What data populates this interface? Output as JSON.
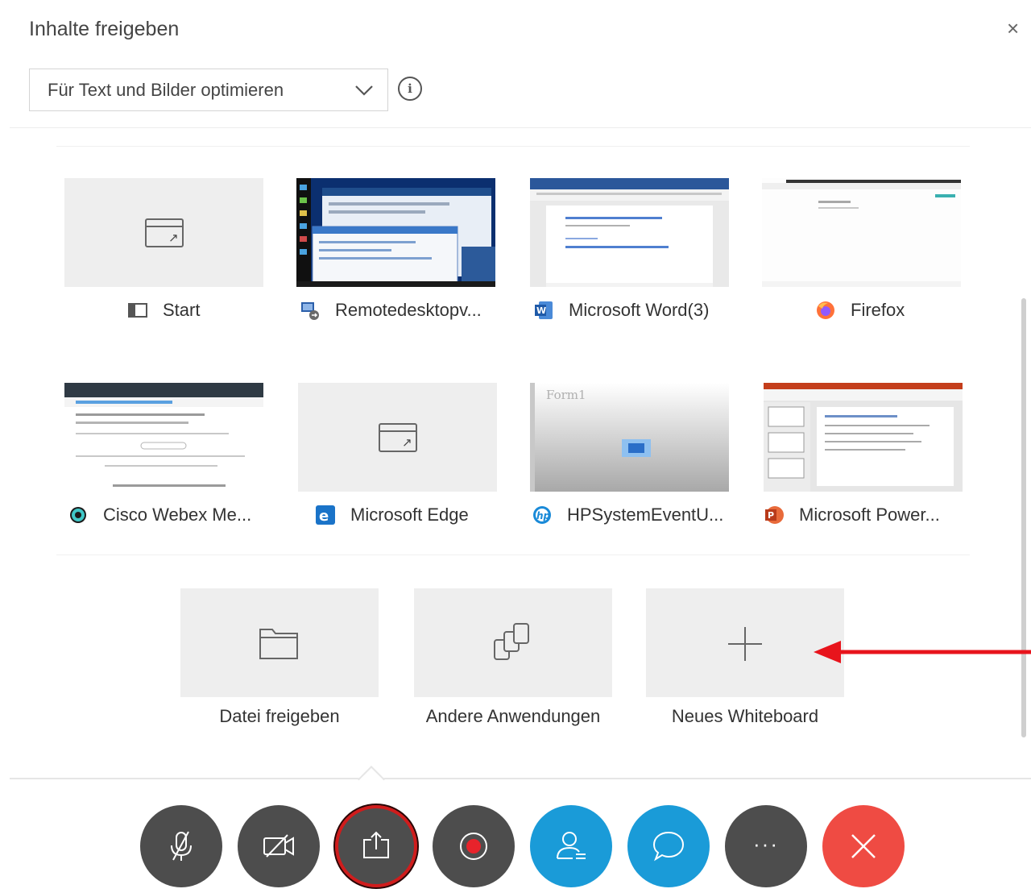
{
  "dialog": {
    "title": "Inhalte freigeben",
    "close_label": "×"
  },
  "optimize": {
    "selected": "Für Text und Bilder optimieren",
    "info_label": "i"
  },
  "windows": [
    {
      "label": "Start",
      "icon": "start-window-icon",
      "thumbnail": "placeholder"
    },
    {
      "label": "Remotedesktopv...",
      "icon": "remote-desktop-icon",
      "thumbnail": "desktop-screenshot"
    },
    {
      "label": "Microsoft Word(3)",
      "icon": "word-icon",
      "thumbnail": "word-document"
    },
    {
      "label": "Firefox",
      "icon": "firefox-icon",
      "thumbnail": "browser-page"
    },
    {
      "label": "Cisco Webex Me...",
      "icon": "webex-icon",
      "thumbnail": "webex-window"
    },
    {
      "label": "Microsoft Edge",
      "icon": "edge-icon",
      "thumbnail": "placeholder"
    },
    {
      "label": "HPSystemEventU...",
      "icon": "hp-icon",
      "thumbnail": "form-window"
    },
    {
      "label": "Microsoft Power...",
      "icon": "powerpoint-icon",
      "thumbnail": "powerpoint-window"
    }
  ],
  "form_thumb_title": "Form1",
  "actions": [
    {
      "label": "Datei freigeben",
      "icon": "folder-icon"
    },
    {
      "label": "Andere Anwendungen",
      "icon": "app-stack-icon"
    },
    {
      "label": "Neues Whiteboard",
      "icon": "plus-icon"
    }
  ],
  "toolbar": [
    {
      "name": "mute-button",
      "icon": "microphone-muted-icon",
      "color": "#4d4d4d"
    },
    {
      "name": "video-button",
      "icon": "camera-off-icon",
      "color": "#4d4d4d"
    },
    {
      "name": "share-button",
      "icon": "share-icon",
      "color": "#4d4d4d",
      "active": true
    },
    {
      "name": "record-button",
      "icon": "record-icon",
      "color": "#4d4d4d"
    },
    {
      "name": "participants-button",
      "icon": "participants-icon",
      "color": "#1a9bd8"
    },
    {
      "name": "chat-button",
      "icon": "chat-icon",
      "color": "#1a9bd8"
    },
    {
      "name": "more-button",
      "icon": "more-icon",
      "color": "#4d4d4d",
      "label": "···"
    },
    {
      "name": "end-meeting-button",
      "icon": "close-icon",
      "color": "#ef4b43"
    }
  ],
  "annotation_color": "#e8141c"
}
